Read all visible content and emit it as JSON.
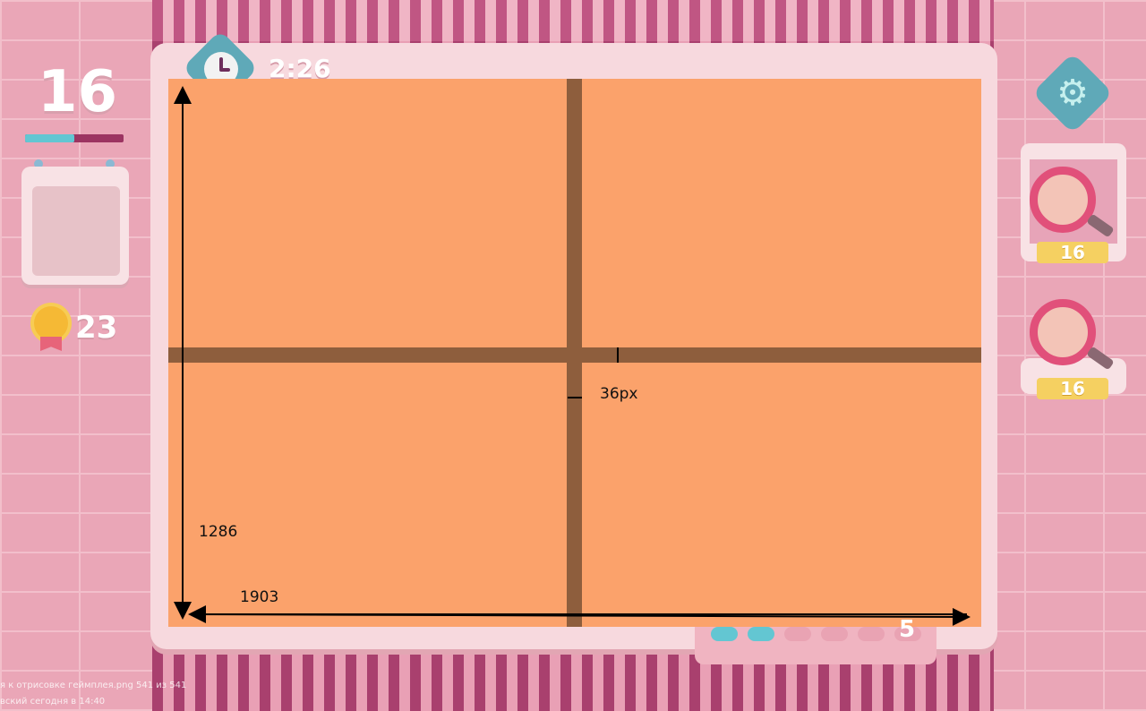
{
  "hud": {
    "level_number": "16",
    "progress_fraction": 0.5,
    "timer": "2:26",
    "medals": "23"
  },
  "hints": [
    {
      "count": "16"
    },
    {
      "count": "16"
    }
  ],
  "tray": {
    "count": "5",
    "filled": 2,
    "total": 6
  },
  "annotations": {
    "height_label": "1286",
    "width_label": "1903",
    "gap_label": "36px"
  },
  "footer": {
    "line1": "я к отрисовке геймплея.png 541 из 541",
    "line2": "вский   сегодня в 14:40"
  },
  "colors": {
    "panel_fill": "#fba26b",
    "divider": "#8e5e3d",
    "accent_teal": "#5fa9b8",
    "hint_badge": "#f5d061"
  },
  "icons": [
    "clock-icon",
    "gear-icon",
    "medal-icon",
    "magnifier-icon"
  ]
}
